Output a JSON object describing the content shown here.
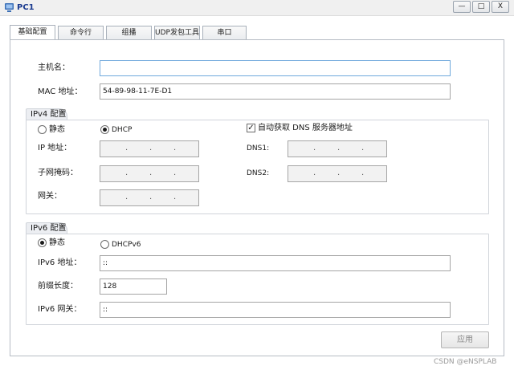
{
  "window": {
    "title": "PC1",
    "minimize": "—",
    "maximize": "□",
    "close": "X"
  },
  "tabs": [
    {
      "label": "基础配置"
    },
    {
      "label": "命令行"
    },
    {
      "label": "组播"
    },
    {
      "label": "UDP发包工具"
    },
    {
      "label": "串口"
    }
  ],
  "basic": {
    "hostname_label": "主机名：",
    "hostname_value": "",
    "mac_label": "MAC 地址：",
    "mac_value": "54-89-98-11-7E-D1"
  },
  "ipv4": {
    "title": "IPv4 配置",
    "static_label": "静态",
    "dhcp_label": "DHCP",
    "selected": "DHCP",
    "auto_dns_label": "自动获取 DNS 服务器地址",
    "auto_dns_checked": true,
    "check_glyph": "✓",
    "ip_label": "IP 地址：",
    "mask_label": "子网掩码：",
    "gateway_label": "网关：",
    "dns1_label": "DNS1:",
    "dns2_label": "DNS2:"
  },
  "ipv6": {
    "title": "IPv6 配置",
    "static_label": "静态",
    "dhcpv6_label": "DHCPv6",
    "selected": "静态",
    "ip_label": "IPv6 地址：",
    "ip_value": "::",
    "prefix_label": "前缀长度：",
    "prefix_value": "128",
    "gateway_label": "IPv6 网关：",
    "gateway_value": "::"
  },
  "actions": {
    "apply_label": "应用"
  },
  "watermark": "CSDN @eNSPLAB",
  "icons": {
    "app_icon": "pc-icon"
  }
}
